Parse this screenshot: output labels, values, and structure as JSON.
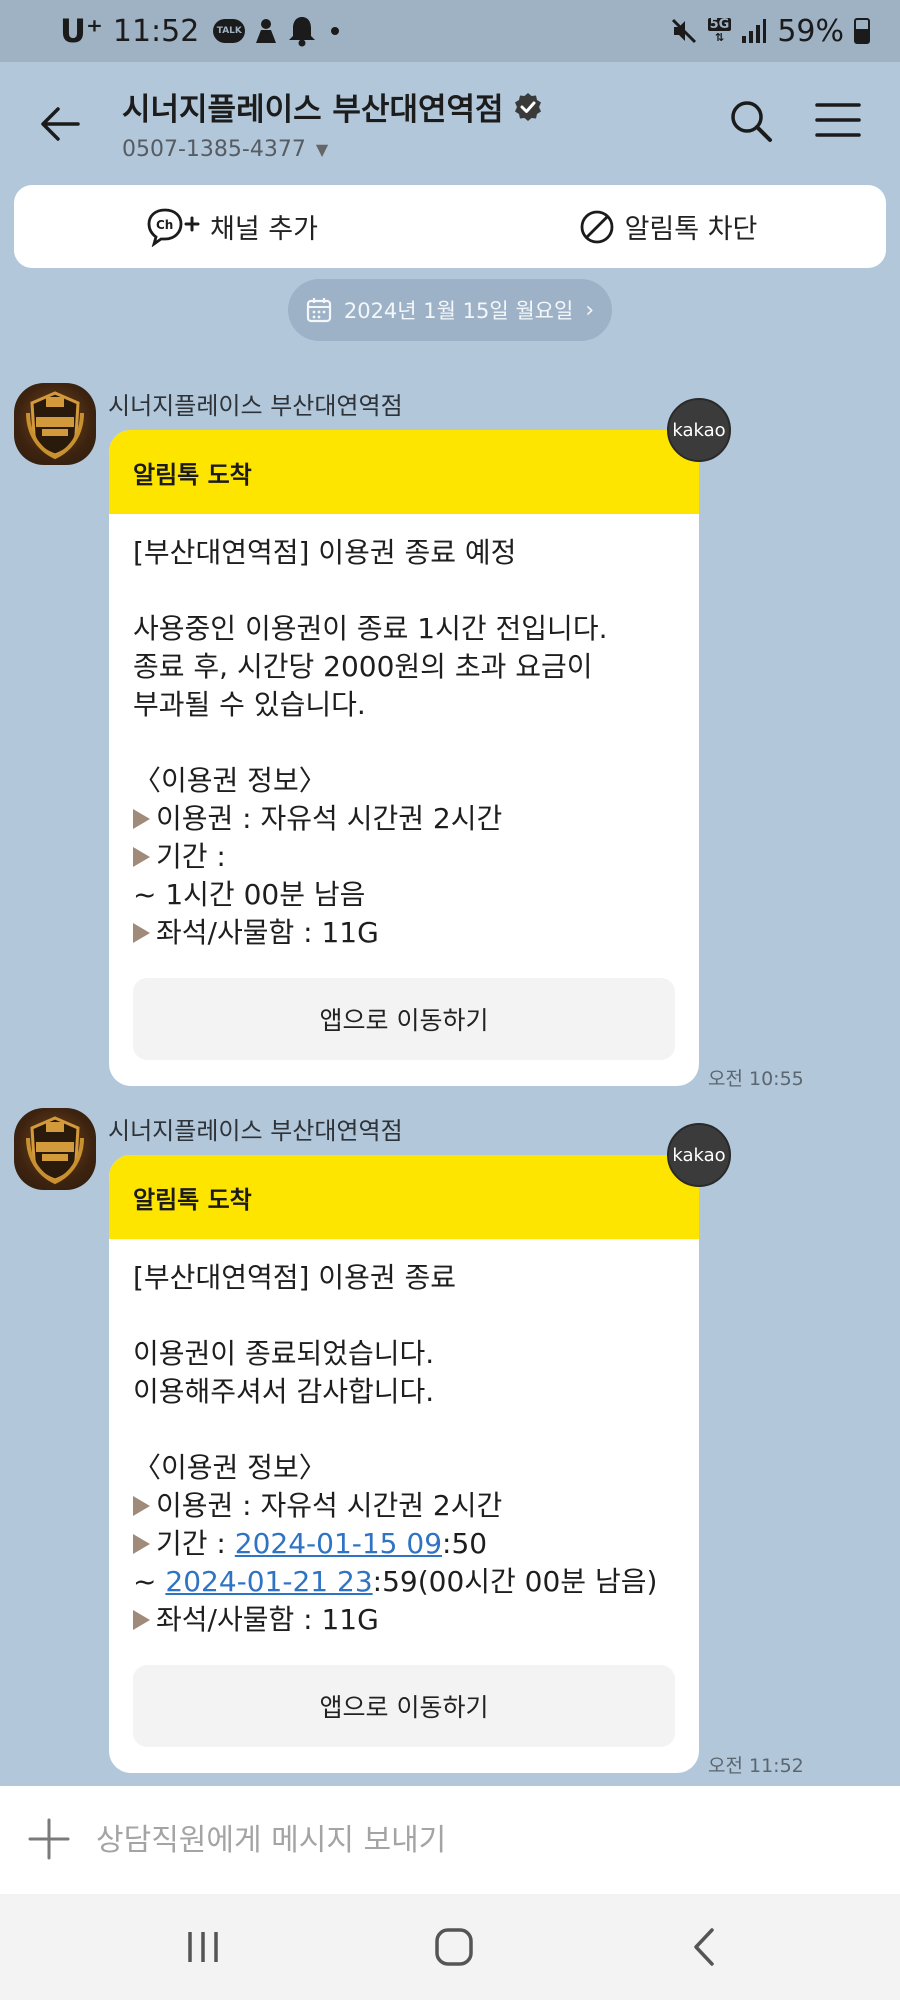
{
  "status": {
    "carrier": "U⁺",
    "time": "11:52",
    "talk_badge": "TALK",
    "network": "5G",
    "battery": "59%",
    "battery_level": 0.59
  },
  "header": {
    "title": "시너지플레이스 부산대연역점",
    "phone": "0507-1385-4377"
  },
  "actions": {
    "add_channel": "채널 추가",
    "block": "알림톡 차단"
  },
  "date_divider": "2024년 1월 15일 월요일",
  "messages": [
    {
      "sender": "시너지플레이스 부산대연역점",
      "badge": "kakao",
      "head": "알림톡 도착",
      "line1": "[부산대연역점] 이용권 종료 예정",
      "line2": "사용중인 이용권이 종료 1시간 전입니다.",
      "line3": "종료 후, 시간당 2000원의 초과 요금이",
      "line4": "부과될 수 있습니다.",
      "line5": "〈이용권 정보〉",
      "line6": "이용권 : 자유석 시간권 2시간",
      "line7": "기간 :",
      "line8": "~ 1시간 00분 남음",
      "line9": "좌석/사물함 : 11G",
      "button": "앱으로 이동하기",
      "time": "오전 10:55"
    },
    {
      "sender": "시너지플레이스 부산대연역점",
      "badge": "kakao",
      "head": "알림톡 도착",
      "line1": "[부산대연역점] 이용권 종료",
      "line2": "이용권이 종료되었습니다.",
      "line3": "이용해주셔서 감사합니다.",
      "line4": "〈이용권 정보〉",
      "line5": "이용권 : 자유석 시간권 2시간",
      "line6_prefix": "기간 : ",
      "line6_link": "2024-01-15 09",
      "line6_suffix": ":50",
      "line7_prefix": "~ ",
      "line7_link": "2024-01-21 23",
      "line7_suffix": ":59(00시간 00분 남음)",
      "line8": "좌석/사물함 : 11G",
      "button": "앱으로 이동하기",
      "time": "오전 11:52"
    }
  ],
  "input": {
    "placeholder": "상담직원에게 메시지 보내기"
  },
  "colors": {
    "background": "#b2c7da",
    "accent_yellow": "#fee500",
    "link": "#2f73c4"
  }
}
